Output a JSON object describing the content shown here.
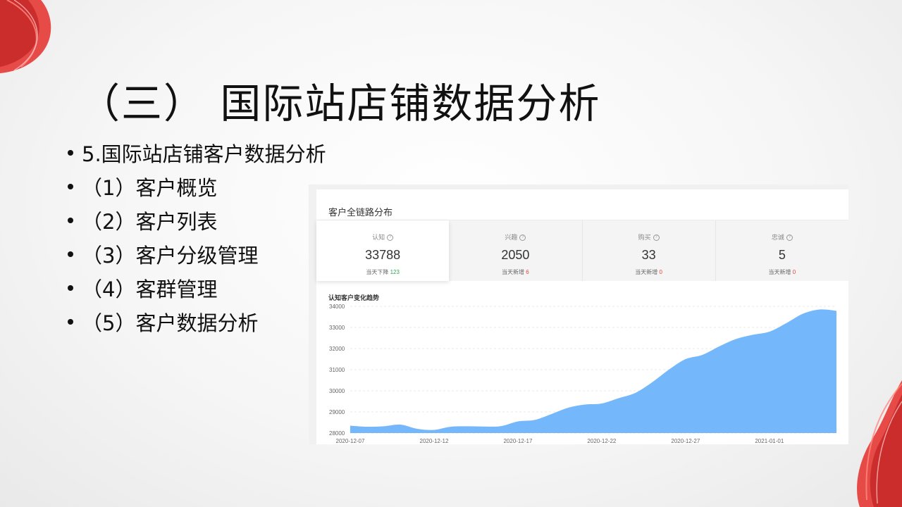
{
  "slide": {
    "title": "（三） 国际站店铺数据分析",
    "bullets": [
      "5.国际站店铺客户数据分析",
      "（1）客户概览",
      "（2）客户列表",
      "（3）客户分级管理",
      "（4）客群管理",
      "（5）客户数据分析"
    ]
  },
  "panel": {
    "header": "客户全链路分布",
    "metrics": [
      {
        "label": "认知",
        "value": "33788",
        "sub_prefix": "当天下降",
        "sub_value": "123",
        "sub_color": "green"
      },
      {
        "label": "兴趣",
        "value": "2050",
        "sub_prefix": "当天新增",
        "sub_value": "6",
        "sub_color": "red"
      },
      {
        "label": "购买",
        "value": "33",
        "sub_prefix": "当天新增",
        "sub_value": "0",
        "sub_color": "red"
      },
      {
        "label": "忠诚",
        "value": "5",
        "sub_prefix": "当天新增",
        "sub_value": "0",
        "sub_color": "red"
      }
    ],
    "help_icon_glyph": "?",
    "chart_title": "认知客户变化趋势"
  },
  "colors": {
    "area_fill": "#74b8fb",
    "ribbon_red": "#e02020"
  },
  "chart_data": {
    "type": "area",
    "title": "认知客户变化趋势",
    "xlabel": "",
    "ylabel": "",
    "ylim": [
      28000,
      34000
    ],
    "y_ticks": [
      28000,
      29000,
      30000,
      31000,
      32000,
      33000,
      34000
    ],
    "x_tick_labels": [
      "2020-12-07",
      "2020-12-12",
      "2020-12-17",
      "2020-12-22",
      "2020-12-27",
      "2021-01-01"
    ],
    "x": [
      "2020-12-07",
      "2020-12-08",
      "2020-12-09",
      "2020-12-10",
      "2020-12-11",
      "2020-12-12",
      "2020-12-13",
      "2020-12-14",
      "2020-12-15",
      "2020-12-16",
      "2020-12-17",
      "2020-12-18",
      "2020-12-19",
      "2020-12-20",
      "2020-12-21",
      "2020-12-22",
      "2020-12-23",
      "2020-12-24",
      "2020-12-25",
      "2020-12-26",
      "2020-12-27",
      "2020-12-28",
      "2020-12-29",
      "2020-12-30",
      "2020-12-31",
      "2021-01-01",
      "2021-01-02",
      "2021-01-03",
      "2021-01-04",
      "2021-01-05"
    ],
    "values": [
      28350,
      28300,
      28320,
      28400,
      28200,
      28150,
      28300,
      28320,
      28310,
      28330,
      28550,
      28620,
      28900,
      29200,
      29350,
      29400,
      29650,
      29900,
      30400,
      31000,
      31500,
      31700,
      32100,
      32450,
      32650,
      32800,
      33200,
      33650,
      33850,
      33788
    ],
    "grid": true,
    "legend": "none"
  }
}
